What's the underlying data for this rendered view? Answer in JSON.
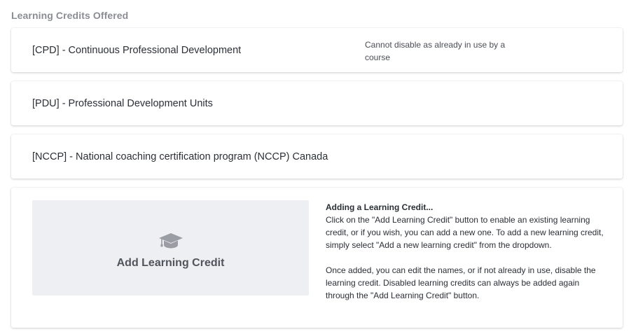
{
  "section": {
    "title": "Learning Credits Offered"
  },
  "credits": [
    {
      "label": "[CPD] - Continuous Professional Development",
      "note": "Cannot disable as already in use by a course"
    },
    {
      "label": "[PDU] - Professional Development Units",
      "note": ""
    },
    {
      "label": "[NCCP] - National coaching certification program (NCCP) Canada",
      "note": ""
    }
  ],
  "add_credit": {
    "button_label": "Add Learning Credit",
    "icon": "graduation-cap-icon",
    "help_heading": "Adding a Learning Credit...",
    "help_p1": "Click on the \"Add Learning Credit\" button to enable an existing learning credit, or if you wish, you can add a new one. To add a new learning credit, simply select \"Add a new learning credit\" from the dropdown.",
    "help_p2": "Once added, you can edit the names, or if not already in use, disable the learning credit. Disabled learning credits can always be added again through the \"Add Learning Credit\" button."
  },
  "colors": {
    "section_title": "#8a8d93",
    "button_bg": "#eeeff2",
    "icon": "#9a9da3"
  }
}
